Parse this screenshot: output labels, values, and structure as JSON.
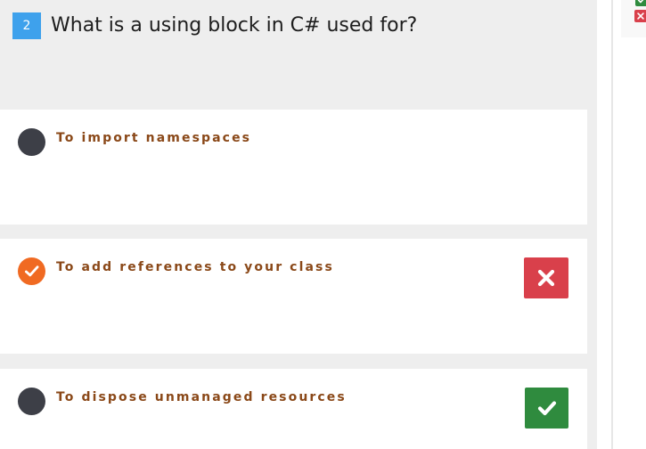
{
  "question": {
    "number": "2",
    "text": "What is a using block in C# used for?"
  },
  "answers": [
    {
      "text": "To import namespaces",
      "selected": false,
      "result": "none"
    },
    {
      "text": "To add references to your class",
      "selected": true,
      "result": "wrong"
    },
    {
      "text": "To dispose unmanaged resources",
      "selected": false,
      "result": "correct"
    }
  ],
  "icons": {
    "selected_check": "check-icon",
    "wrong_result": "x-icon",
    "correct_result": "check-icon"
  },
  "colors": {
    "panel_background": "#eeeeee",
    "question_badge": "#3ea1ec",
    "answer_text": "#8a4818",
    "radio_unselected": "#3d3f47",
    "radio_selected": "#f06a22",
    "wrong": "#d9404b",
    "correct": "#2f8b3e"
  }
}
